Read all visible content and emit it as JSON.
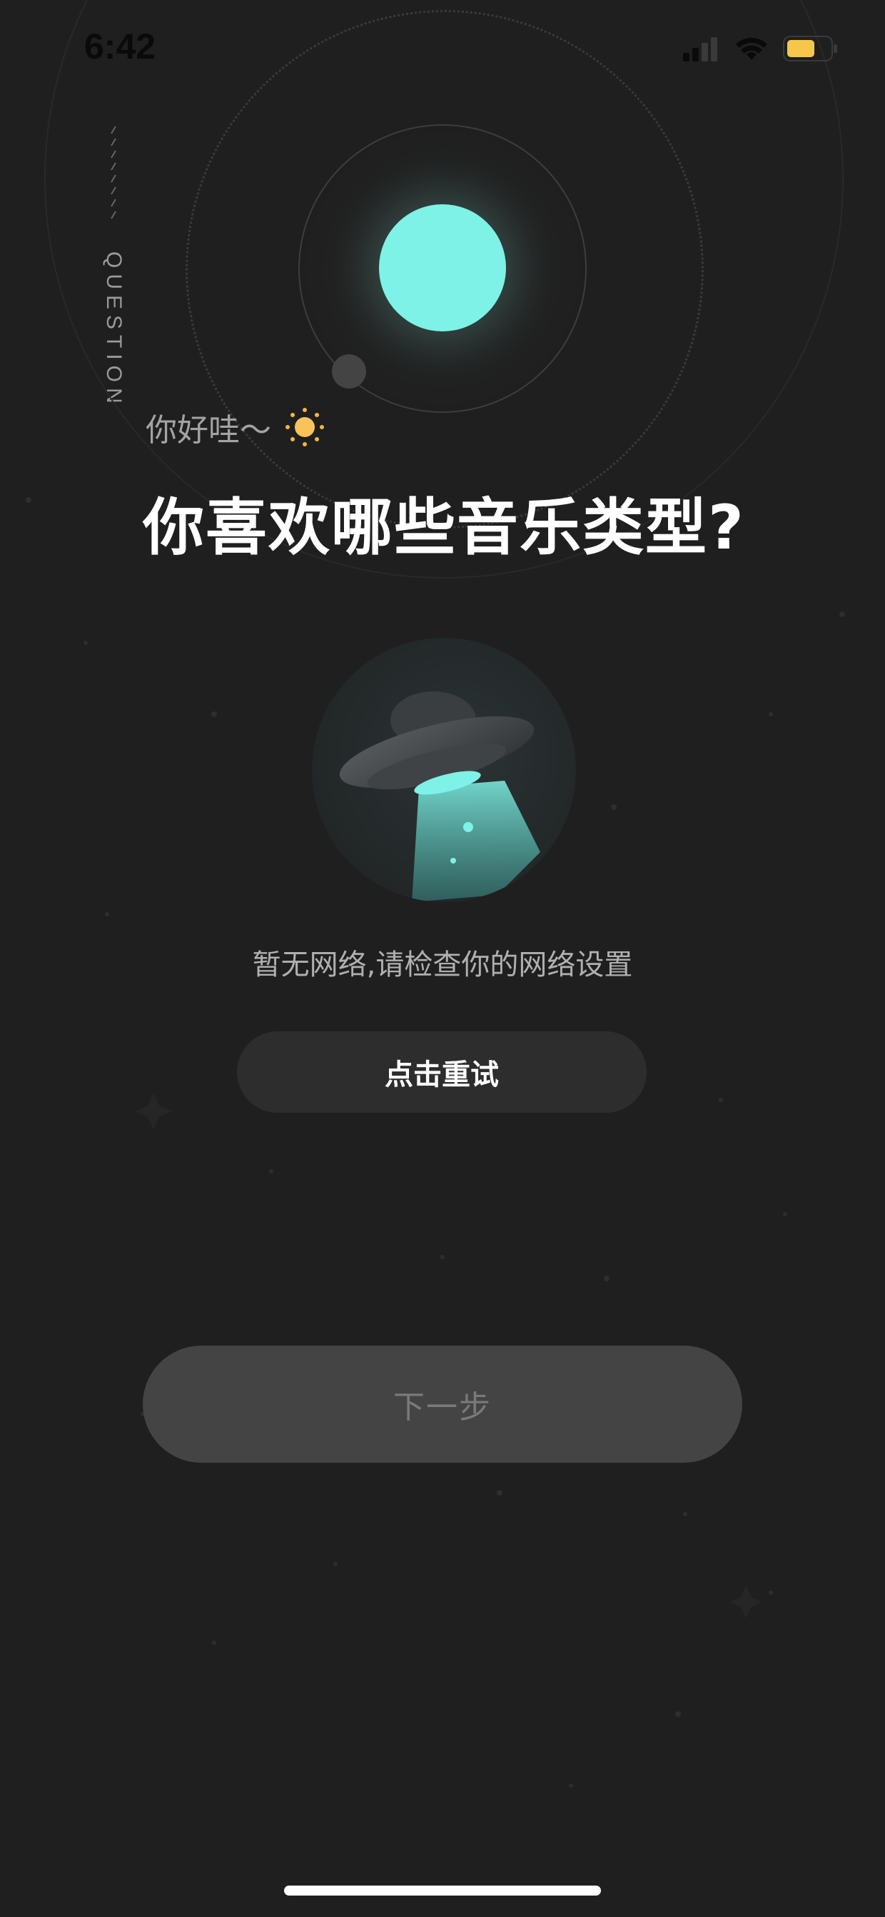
{
  "status_bar": {
    "time": "6:42",
    "icons": [
      "signal-icon",
      "wifi-icon",
      "battery-icon"
    ],
    "battery_color": "#f5c84b"
  },
  "side_label": {
    "text": "QUESTION",
    "slashes": "////////"
  },
  "greeting": {
    "text": "你好哇～",
    "icon": "sun-icon"
  },
  "title": "你喜欢哪些音乐类型?",
  "illustration": {
    "icon": "ufo-icon"
  },
  "error": {
    "message": "暂无网络,请检查你的网络设置"
  },
  "retry_button": {
    "label": "点击重试"
  },
  "next_button": {
    "label": "下一步",
    "state": "disabled"
  },
  "colors": {
    "background": "#1f1f1f",
    "accent": "#7ef2e6",
    "button": "#2d2d2d",
    "button_disabled": "#444444"
  }
}
